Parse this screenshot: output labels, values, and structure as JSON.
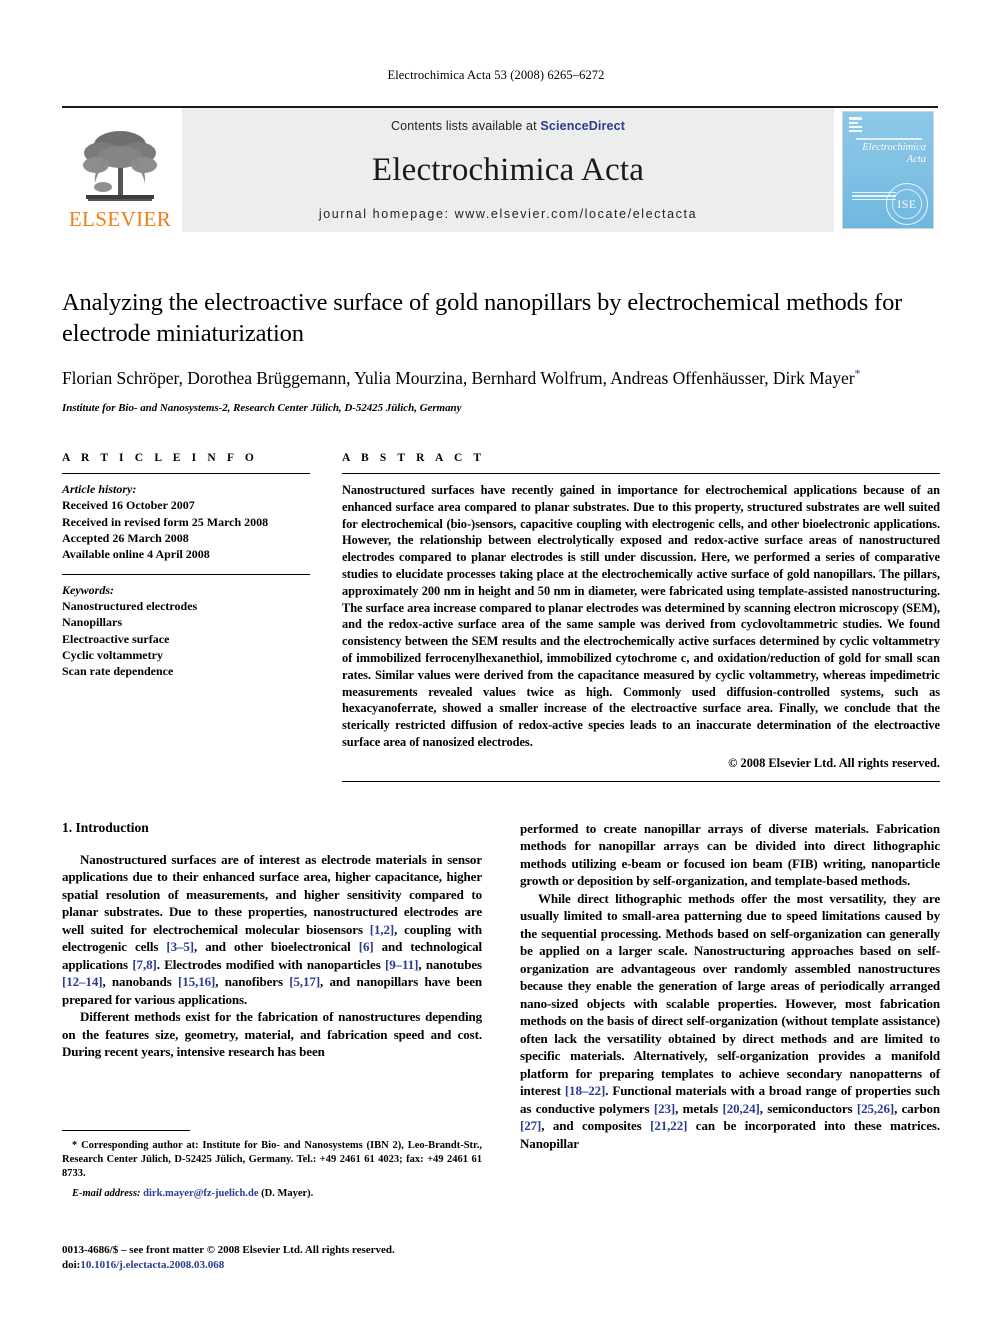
{
  "running_head": "Electrochimica Acta 53 (2008) 6265–6272",
  "masthead": {
    "publisher_name": "ELSEVIER",
    "contents_prefix": "Contents lists available at ",
    "sciencedirect_label": "ScienceDirect",
    "journal_title": "Electrochimica Acta",
    "homepage_line": "journal homepage: www.elsevier.com/locate/electacta",
    "cover": {
      "journal_name_line1": "Electrochimica",
      "journal_name_line2": "Acta",
      "seal_label": "ISE"
    },
    "colors": {
      "elsevier_orange": "#F07F13",
      "link_blue": "#2a3b91",
      "masthead_grey": "#eceded",
      "cover_blue": "#7fc0e4"
    }
  },
  "title_block": {
    "title": "Analyzing the electroactive surface of gold nanopillars by electrochemical methods for electrode miniaturization",
    "authors": "Florian Schröper, Dorothea Brüggemann, Yulia Mourzina, Bernhard Wolfrum, Andreas Offenhäusser, Dirk Mayer",
    "corresponding_marker": "*",
    "affiliation": "Institute for Bio- and Nanosystems-2, Research Center Jülich, D-52425 Jülich, Germany"
  },
  "article_info": {
    "heading": "A R T I C L E  I N F O",
    "history_label": "Article history:",
    "history": [
      "Received 16 October 2007",
      "Received in revised form 25 March 2008",
      "Accepted 26 March 2008",
      "Available online 4 April 2008"
    ],
    "keywords_label": "Keywords:",
    "keywords": [
      "Nanostructured electrodes",
      "Nanopillars",
      "Electroactive surface",
      "Cyclic voltammetry",
      "Scan rate dependence"
    ]
  },
  "abstract": {
    "heading": "A B S T R A C T",
    "text": "Nanostructured surfaces have recently gained in importance for electrochemical applications because of an enhanced surface area compared to planar substrates. Due to this property, structured substrates are well suited for electrochemical (bio-)sensors, capacitive coupling with electrogenic cells, and other bioelectronic applications. However, the relationship between electrolytically exposed and redox-active surface areas of nanostructured electrodes compared to planar electrodes is still under discussion. Here, we performed a series of comparative studies to elucidate processes taking place at the electrochemically active surface of gold nanopillars. The pillars, approximately 200 nm in height and 50 nm in diameter, were fabricated using template-assisted nanostructuring. The surface area increase compared to planar electrodes was determined by scanning electron microscopy (SEM), and the redox-active surface area of the same sample was derived from cyclovoltammetric studies. We found consistency between the SEM results and the electrochemically active surfaces determined by cyclic voltammetry of immobilized ferrocenylhexanethiol, immobilized cytochrome c, and oxidation/reduction of gold for small scan rates. Similar values were derived from the capacitance measured by cyclic voltammetry, whereas impedimetric measurements revealed values twice as high. Commonly used diffusion-controlled systems, such as hexacyanoferrate, showed a smaller increase of the electroactive surface area. Finally, we conclude that the sterically restricted diffusion of redox-active species leads to an inaccurate determination of the electroactive surface area of nanosized electrodes.",
    "copyright": "© 2008 Elsevier Ltd. All rights reserved."
  },
  "body": {
    "section_number_title": "1.  Introduction",
    "left_paragraph_1": "Nanostructured surfaces are of interest as electrode materials in sensor applications due to their enhanced surface area, higher capacitance, higher spatial resolution of measurements, and higher sensitivity compared to planar substrates. Due to these properties, nanostructured electrodes are well suited for electrochemical molecular biosensors [1,2], coupling with electrogenic cells [3–5], and other bioelectronical [6] and technological applications [7,8]. Electrodes modified with nanoparticles [9–11], nanotubes [12–14], nanobands [15,16], nanofibers [5,17], and nanopillars have been prepared for various applications.",
    "left_paragraph_2": "Different methods exist for the fabrication of nanostructures depending on the features size, geometry, material, and fabrication speed and cost. During recent years, intensive research has been",
    "right_paragraph_1": "performed to create nanopillar arrays of diverse materials. Fabrication methods for nanopillar arrays can be divided into direct lithographic methods utilizing e-beam or focused ion beam (FIB) writing, nanoparticle growth or deposition by self-organization, and template-based methods.",
    "right_paragraph_2": "While direct lithographic methods offer the most versatility, they are usually limited to small-area patterning due to speed limitations caused by the sequential processing. Methods based on self-organization can generally be applied on a larger scale. Nanostructuring approaches based on self-organization are advantageous over randomly assembled nanostructures because they enable the generation of large areas of periodically arranged nano-sized objects with scalable properties. However, most fabrication methods on the basis of direct self-organization (without template assistance) often lack the versatility obtained by direct methods and are limited to specific materials. Alternatively, self-organization provides a manifold platform for preparing templates to achieve secondary nanopatterns of interest [18–22]. Functional materials with a broad range of properties such as conductive polymers [23], metals [20,24], semiconductors [25,26], carbon [27], and composites [21,22] can be incorporated into these matrices. Nanopillar"
  },
  "footnote": {
    "corresponding": "* Corresponding author at: Institute for Bio- and Nanosystems (IBN 2), Leo-Brandt-Str., Research Center Jülich, D-52425 Jülich, Germany. Tel.: +49 2461 61 4023; fax: +49 2461 61 8733.",
    "email_label": "E-mail address:",
    "email": "dirk.mayer@fz-juelich.de",
    "email_suffix": "(D. Mayer)."
  },
  "issn_footer": {
    "line1": "0013-4686/$ – see front matter © 2008 Elsevier Ltd. All rights reserved.",
    "doi_label": "doi:",
    "doi": "10.1016/j.electacta.2008.03.068"
  }
}
